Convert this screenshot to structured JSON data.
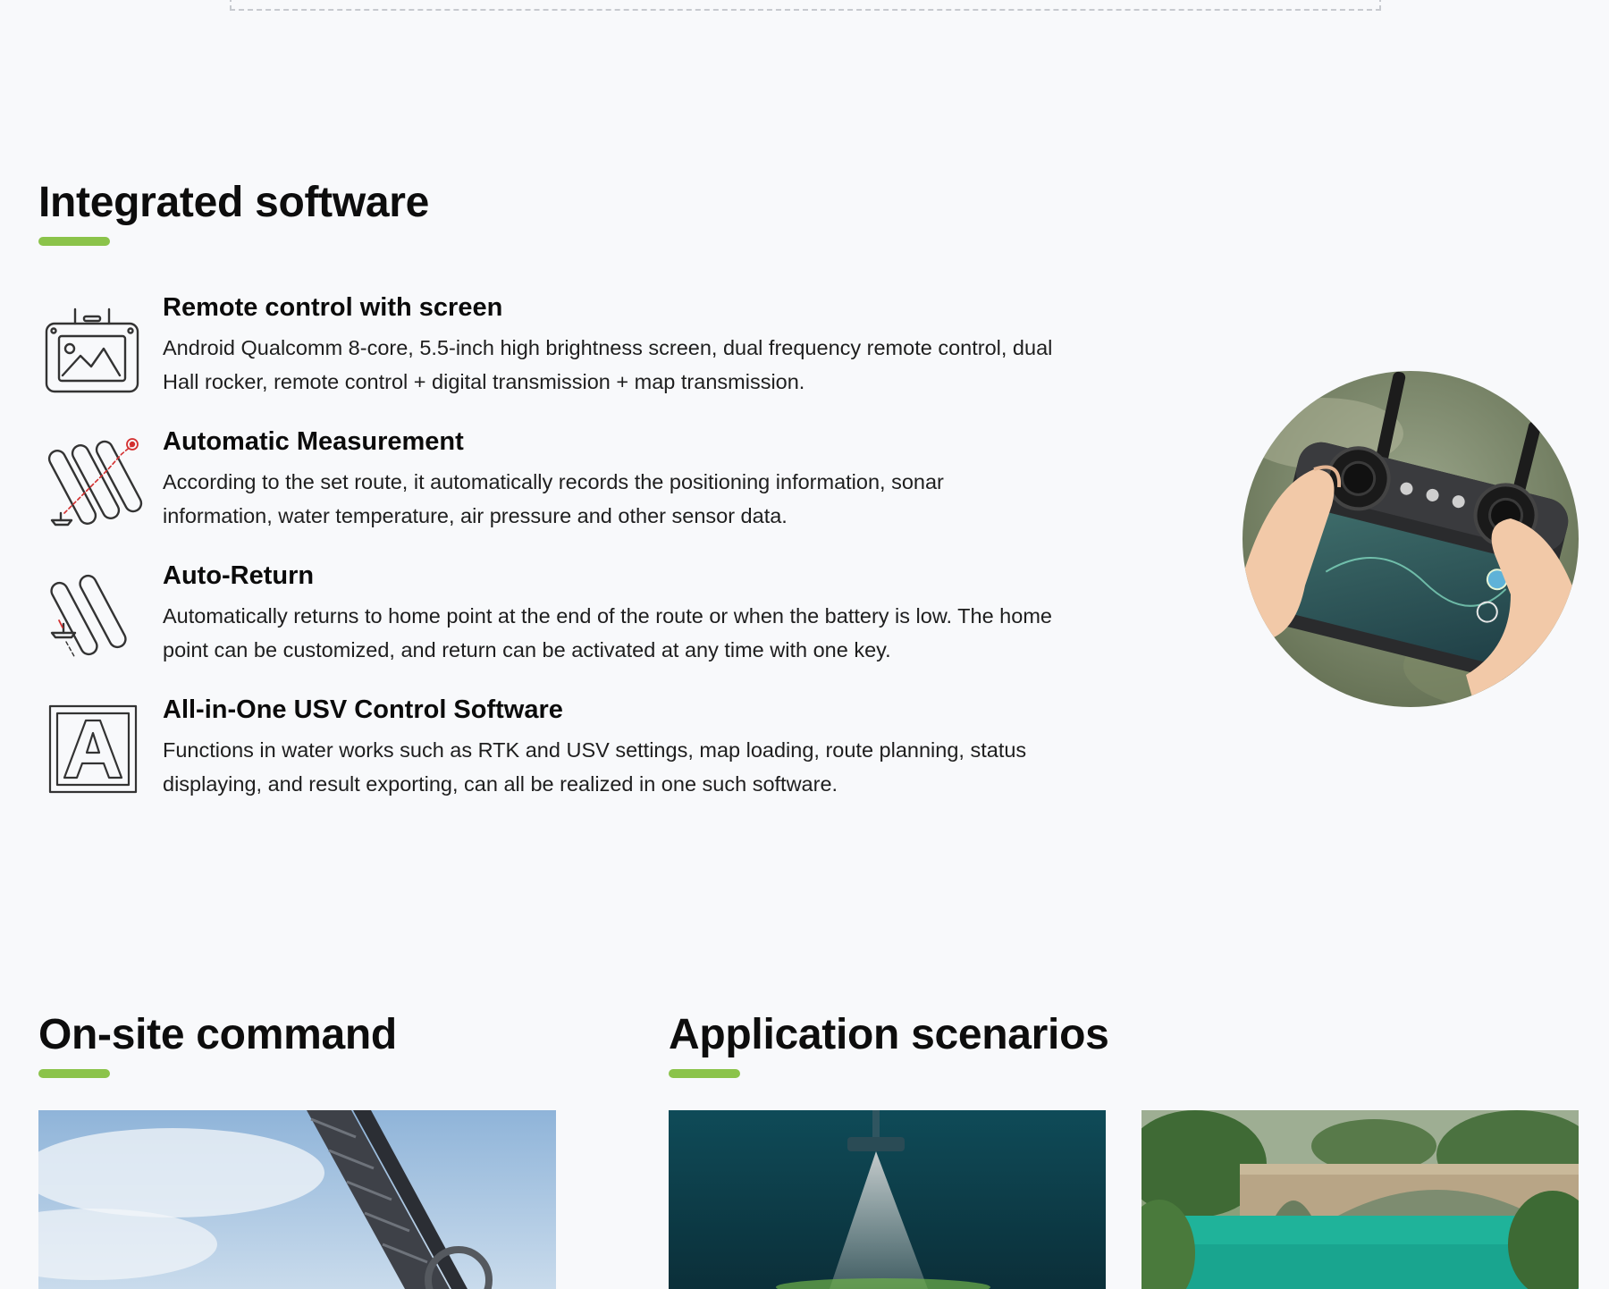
{
  "colors": {
    "accent": "#8bc34a",
    "background": "#f8f9fb",
    "text": "#111111"
  },
  "software": {
    "title": "Integrated software",
    "features": [
      {
        "icon": "remote-controller-icon",
        "title": "Remote control with screen",
        "description": "Android Qualcomm 8-core, 5.5-inch high brightness screen, dual frequency remote control, dual Hall rocker, remote control + digital transmission + map transmission."
      },
      {
        "icon": "route-measurement-icon",
        "title": "Automatic Measurement",
        "description": "According to the set route, it automatically records the positioning information, sonar information, water temperature, air pressure and other sensor data."
      },
      {
        "icon": "auto-return-icon",
        "title": "Auto-Return",
        "description": "Automatically returns to home point at the end of the route or when the battery is low. The home point can be customized, and return can be activated at any time with one key."
      },
      {
        "icon": "software-app-icon",
        "title": "All-in-One USV Control Software",
        "description": "Functions in water works such as RTK and USV settings, map loading, route planning, status displaying, and result exporting, can all be realized in one such software."
      }
    ],
    "image": "remote-controller-photo"
  },
  "onsite": {
    "title": "On-site command",
    "image": "bridge-steel-structure-photo"
  },
  "scenarios": {
    "title": "Application scenarios",
    "images": [
      "underwater-sonar-photo",
      "lake-bridge-photo"
    ]
  }
}
